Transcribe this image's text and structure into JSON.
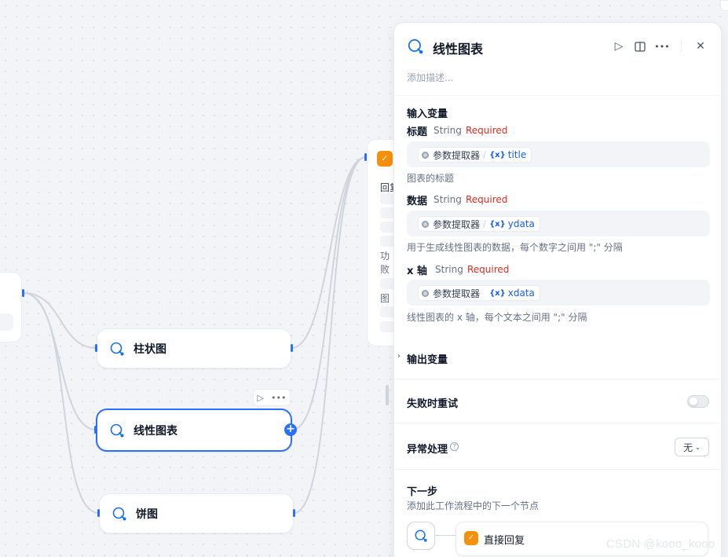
{
  "canvas": {
    "nodes": [
      {
        "id": "bar",
        "title": "柱状图"
      },
      {
        "id": "line",
        "title": "线性图表"
      },
      {
        "id": "pie",
        "title": "饼图"
      }
    ],
    "answer_node": {
      "rows": [
        "回复",
        "功",
        "败",
        "图"
      ]
    }
  },
  "panel": {
    "title": "线性图表",
    "description_placeholder": "添加描述...",
    "input_section": "输入变量",
    "inputs": [
      {
        "label": "标题",
        "type": "String",
        "required": "Required",
        "source": "参数提取器",
        "var": "title",
        "help": "图表的标题"
      },
      {
        "label": "数据",
        "type": "String",
        "required": "Required",
        "source": "参数提取器",
        "var": "ydata",
        "help": "用于生成线性图表的数据，每个数字之间用 \";\" 分隔"
      },
      {
        "label": "x 轴",
        "type": "String",
        "required": "Required",
        "source": "参数提取器",
        "var": "xdata",
        "help": "线性图表的 x 轴，每个文本之间用 \";\" 分隔"
      }
    ],
    "output_section": "输出变量",
    "retry_label": "失败时重试",
    "error_label": "异常处理",
    "error_value": "无",
    "next_step_title": "下一步",
    "next_step_desc": "添加此工作流程中的下一个节点",
    "next_node_label": "直接回复",
    "var_prefix": "{x}"
  },
  "watermark": "CSDN @kooo_kooo",
  "colors": {
    "accent": "#2970ff",
    "required": "#d92d20",
    "answer_icon": "#f79009"
  }
}
